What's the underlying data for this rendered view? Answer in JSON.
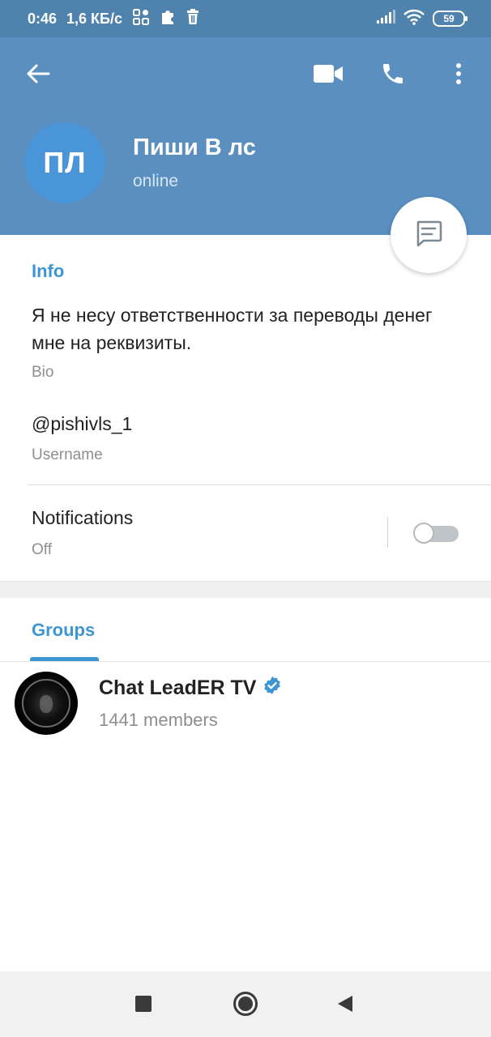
{
  "status_bar": {
    "time": "0:46",
    "speed": "1,6 КБ/с",
    "battery": "59"
  },
  "header": {
    "back_icon": "arrow-left-icon",
    "video_icon": "video-camera-icon",
    "call_icon": "phone-icon",
    "menu_icon": "more-vertical-icon",
    "avatar_initials": "ПЛ",
    "avatar_color": "#4a95d7",
    "header_color": "#5a8fc0",
    "name": "Пиши В лс",
    "status": "online"
  },
  "fab": {
    "icon": "message-icon"
  },
  "info": {
    "title": "Info",
    "bio_text": "Я не несу ответственности за переводы денег мне на реквизиты.",
    "bio_label": "Bio",
    "username": "@pishivls_1",
    "username_label": "Username",
    "notifications_label": "Notifications",
    "notifications_state": "Off",
    "notifications_enabled": false
  },
  "tabs": {
    "active": "Groups",
    "accent_color": "#3d95d2"
  },
  "groups": [
    {
      "name": "Chat LeadER TV",
      "verified": true,
      "members": "1441 members"
    }
  ],
  "navbar": {
    "icons": [
      "recents-square-icon",
      "home-circle-icon",
      "back-triangle-icon"
    ]
  }
}
